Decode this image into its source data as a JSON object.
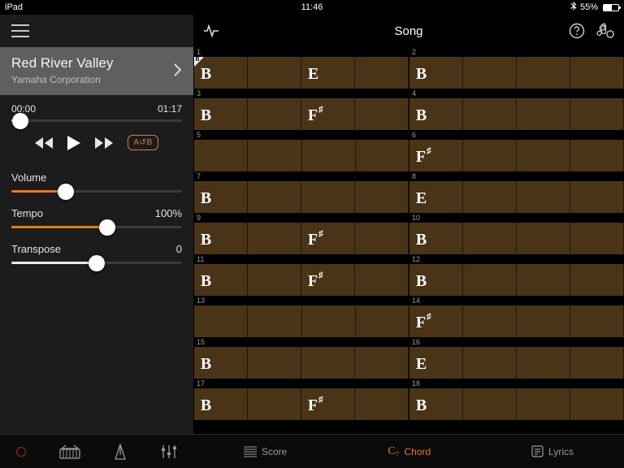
{
  "status": {
    "device": "iPad",
    "time": "11:46",
    "battery_pct": "55%"
  },
  "sidebar": {
    "song": {
      "title": "Red River Valley",
      "artist": "Yamaha Corporation"
    },
    "time": {
      "current": "00:00",
      "total": "01:17",
      "progress_pct": 5
    },
    "abloop_label": "A↺B",
    "controls": {
      "volume": {
        "label": "Volume",
        "value": "",
        "pct": 32
      },
      "tempo": {
        "label": "Tempo",
        "value": "100%",
        "pct": 56
      },
      "transpose": {
        "label": "Transpose",
        "value": "0",
        "pct": 50
      }
    }
  },
  "topbar": {
    "title": "Song"
  },
  "bottom_tabs": {
    "score": "Score",
    "chord": "Chord",
    "lyrics": "Lyrics",
    "chord_prefix": "C₇"
  },
  "grid": {
    "rows": [
      {
        "nums": [
          "1",
          "2"
        ],
        "meas": [
          {
            "chords": [
              {
                "t": "B",
                "beat": 0,
                "first": true
              },
              {
                "t": "E",
                "beat": 2
              }
            ]
          },
          {
            "chords": [
              {
                "t": "B",
                "beat": 0
              }
            ]
          }
        ]
      },
      {
        "nums": [
          "3",
          "4"
        ],
        "meas": [
          {
            "chords": [
              {
                "t": "B",
                "beat": 0
              },
              {
                "t": "F",
                "sup": "♯",
                "beat": 2
              }
            ]
          },
          {
            "chords": [
              {
                "t": "B",
                "beat": 0
              }
            ]
          }
        ]
      },
      {
        "nums": [
          "5",
          "6"
        ],
        "meas": [
          {
            "chords": []
          },
          {
            "chords": [
              {
                "t": "F",
                "sup": "♯",
                "beat": 0
              }
            ]
          }
        ]
      },
      {
        "nums": [
          "7",
          "8"
        ],
        "meas": [
          {
            "chords": [
              {
                "t": "B",
                "beat": 0
              }
            ]
          },
          {
            "chords": [
              {
                "t": "E",
                "beat": 0
              }
            ]
          }
        ]
      },
      {
        "nums": [
          "9",
          "10"
        ],
        "meas": [
          {
            "chords": [
              {
                "t": "B",
                "beat": 0
              },
              {
                "t": "F",
                "sup": "♯",
                "beat": 2
              }
            ]
          },
          {
            "chords": [
              {
                "t": "B",
                "beat": 0
              }
            ]
          }
        ]
      },
      {
        "nums": [
          "11",
          "12"
        ],
        "meas": [
          {
            "chords": [
              {
                "t": "B",
                "beat": 0
              },
              {
                "t": "F",
                "sup": "♯",
                "beat": 2
              }
            ]
          },
          {
            "chords": [
              {
                "t": "B",
                "beat": 0
              }
            ]
          }
        ]
      },
      {
        "nums": [
          "13",
          "14"
        ],
        "meas": [
          {
            "chords": []
          },
          {
            "chords": [
              {
                "t": "F",
                "sup": "♯",
                "beat": 0
              }
            ]
          }
        ]
      },
      {
        "nums": [
          "15",
          "16"
        ],
        "meas": [
          {
            "chords": [
              {
                "t": "B",
                "beat": 0
              }
            ]
          },
          {
            "chords": [
              {
                "t": "E",
                "beat": 0
              }
            ]
          }
        ]
      },
      {
        "nums": [
          "17",
          "18"
        ],
        "meas": [
          {
            "chords": [
              {
                "t": "B",
                "beat": 0
              },
              {
                "t": "F",
                "sup": "♯",
                "beat": 2
              }
            ]
          },
          {
            "chords": [
              {
                "t": "B",
                "beat": 0
              }
            ]
          }
        ]
      }
    ]
  }
}
